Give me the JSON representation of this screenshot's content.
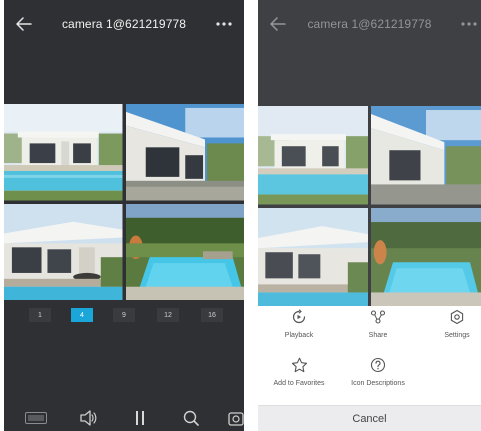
{
  "camera_title": "camera 1@621219778",
  "left": {
    "pages": [
      {
        "label": "1",
        "active": false
      },
      {
        "label": "4",
        "active": true
      },
      {
        "label": "9",
        "active": false
      },
      {
        "label": "12",
        "active": false
      },
      {
        "label": "16",
        "active": false
      }
    ]
  },
  "sheet": {
    "actions": {
      "playback": "Playback",
      "share": "Share",
      "settings": "Settings",
      "favorites": "Add to Favorites",
      "descriptions": "Icon Descriptions"
    },
    "cancel": "Cancel"
  },
  "colors": {
    "app_bg": "#2f3033",
    "accent": "#1aa6d9",
    "sheet_bg": "#ffffff",
    "cancel_bg": "#ececee"
  },
  "icons": {
    "back": "back-arrow-icon",
    "more": "more-dots-icon",
    "toolbar": [
      "sd-quality-icon",
      "speaker-icon",
      "pause-icon",
      "zoom-icon",
      "snapshot-icon"
    ],
    "playback": "playback-icon",
    "share": "share-icon",
    "settings": "settings-icon",
    "favorites": "star-icon",
    "descriptions": "help-icon"
  }
}
